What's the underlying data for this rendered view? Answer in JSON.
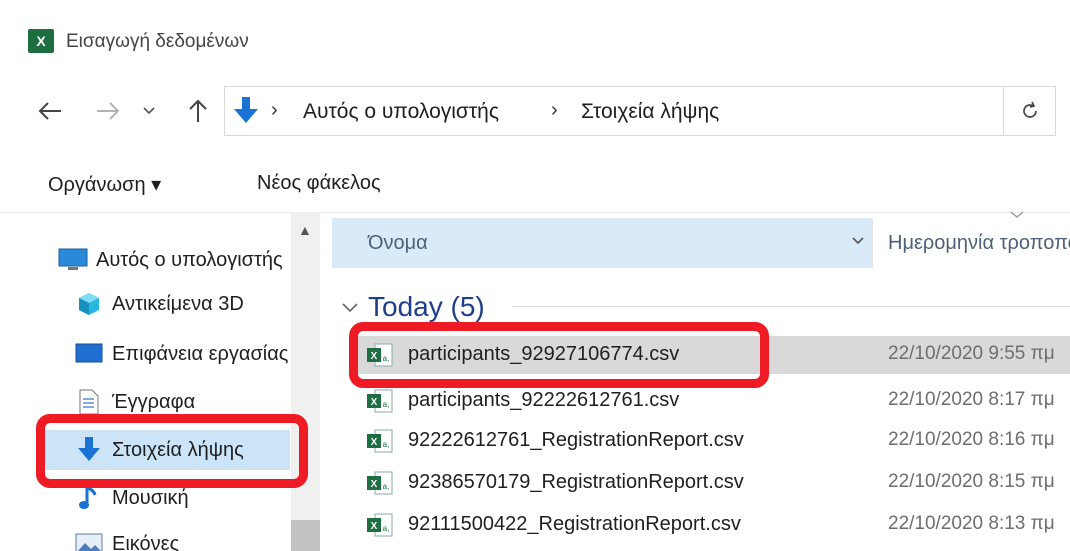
{
  "window": {
    "title": "Εισαγωγή δεδομένων",
    "app_icon_letter": "X"
  },
  "address": {
    "crumbs": [
      "Αυτός ο υπολογιστής",
      "Στοιχεία λήψης"
    ]
  },
  "commands": {
    "organize": "Οργάνωση ▾",
    "new_folder": "Νέος φάκελος"
  },
  "nav": {
    "items": [
      {
        "label": "Αυτός ο υπολογιστής",
        "icon": "computer-icon"
      },
      {
        "label": "Αντικείμενα 3D",
        "icon": "cube-icon"
      },
      {
        "label": "Επιφάνεια εργασίας",
        "icon": "desktop-icon"
      },
      {
        "label": "Έγγραφα",
        "icon": "document-icon"
      },
      {
        "label": "Στοιχεία λήψης",
        "icon": "download-icon"
      },
      {
        "label": "Μουσική",
        "icon": "music-icon"
      },
      {
        "label": "Εικόνες",
        "icon": "pictures-icon"
      }
    ]
  },
  "columns": {
    "name": "Όνομα",
    "date": "Ημερομηνία τροποποίησης"
  },
  "group": {
    "label": "Today (5)"
  },
  "files": [
    {
      "name": "participants_92927106774.csv",
      "date": "22/10/2020 9:55 πμ"
    },
    {
      "name": "participants_92222612761.csv",
      "date": "22/10/2020 8:17 πμ"
    },
    {
      "name": "92222612761_RegistrationReport.csv",
      "date": "22/10/2020 8:16 πμ"
    },
    {
      "name": "92386570179_RegistrationReport.csv",
      "date": "22/10/2020 8:15 πμ"
    },
    {
      "name": "92111500422_RegistrationReport.csv",
      "date": "22/10/2020 8:13 πμ"
    }
  ],
  "colors": {
    "highlight": "#ee1b24",
    "excel_green": "#1d6f42",
    "selection": "#cce4f7"
  }
}
